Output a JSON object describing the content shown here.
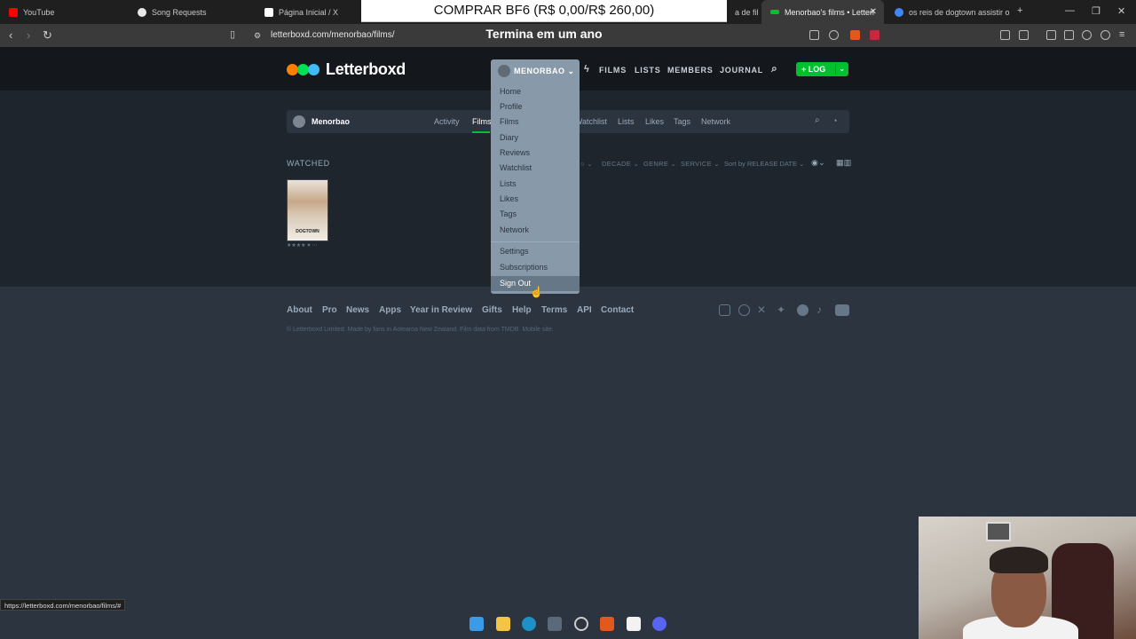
{
  "browser": {
    "tabs": [
      {
        "label": "YouTube",
        "color": "#ff0000"
      },
      {
        "label": "Song Requests",
        "color": "#e8e8e8"
      },
      {
        "label": "Página Inicial / X",
        "color": "#ffffff"
      },
      {
        "label": "a de fil",
        "color": "#888888"
      },
      {
        "label": "Menorbao's films • Letterl",
        "color": "#00c030",
        "active": true
      },
      {
        "label": "os reis de dogtown assistir onl",
        "color": "#4285f4"
      }
    ],
    "url": "letterboxd.com/menorbao/films/",
    "status_url": "https://letterboxd.com/menorbao/films/#"
  },
  "overlay": {
    "banner": "COMPRAR BF6 (R$ 0,00/R$ 260,00)",
    "subtitle": "Termina em um ano"
  },
  "site": {
    "logo": "Letterboxd",
    "logo_colors": [
      "#ff8000",
      "#00e054",
      "#40bcf4"
    ],
    "user_menu": "MENORBAO",
    "nav": [
      "FILMS",
      "LISTS",
      "MEMBERS",
      "JOURNAL"
    ],
    "log_button": "+ LOG"
  },
  "dropdown": {
    "items": [
      "Home",
      "Profile",
      "Films",
      "Diary",
      "Reviews",
      "Watchlist",
      "Lists",
      "Likes",
      "Tags",
      "Network"
    ],
    "items2": [
      "Settings",
      "Subscriptions",
      "Sign Out"
    ]
  },
  "profile": {
    "username": "Menorbao",
    "tabs": [
      "Activity",
      "Films",
      "Watchlist",
      "Lists",
      "Likes",
      "Tags",
      "Network"
    ]
  },
  "films": {
    "section": "WATCHED",
    "filters": [
      "DECADE",
      "GENRE",
      "SERVICE",
      "Sort by RELEASE DATE"
    ],
    "poster_title": "DOGTOWN",
    "rating": "★★★★ ♥ ⋯"
  },
  "footer": {
    "links": [
      "About",
      "Pro",
      "News",
      "Apps",
      "Year in Review",
      "Gifts",
      "Help",
      "Terms",
      "API",
      "Contact"
    ],
    "copyright": "© Letterboxd Limited. Made by fans in Aotearoa New Zealand. Film data from TMDB. Mobile site."
  }
}
